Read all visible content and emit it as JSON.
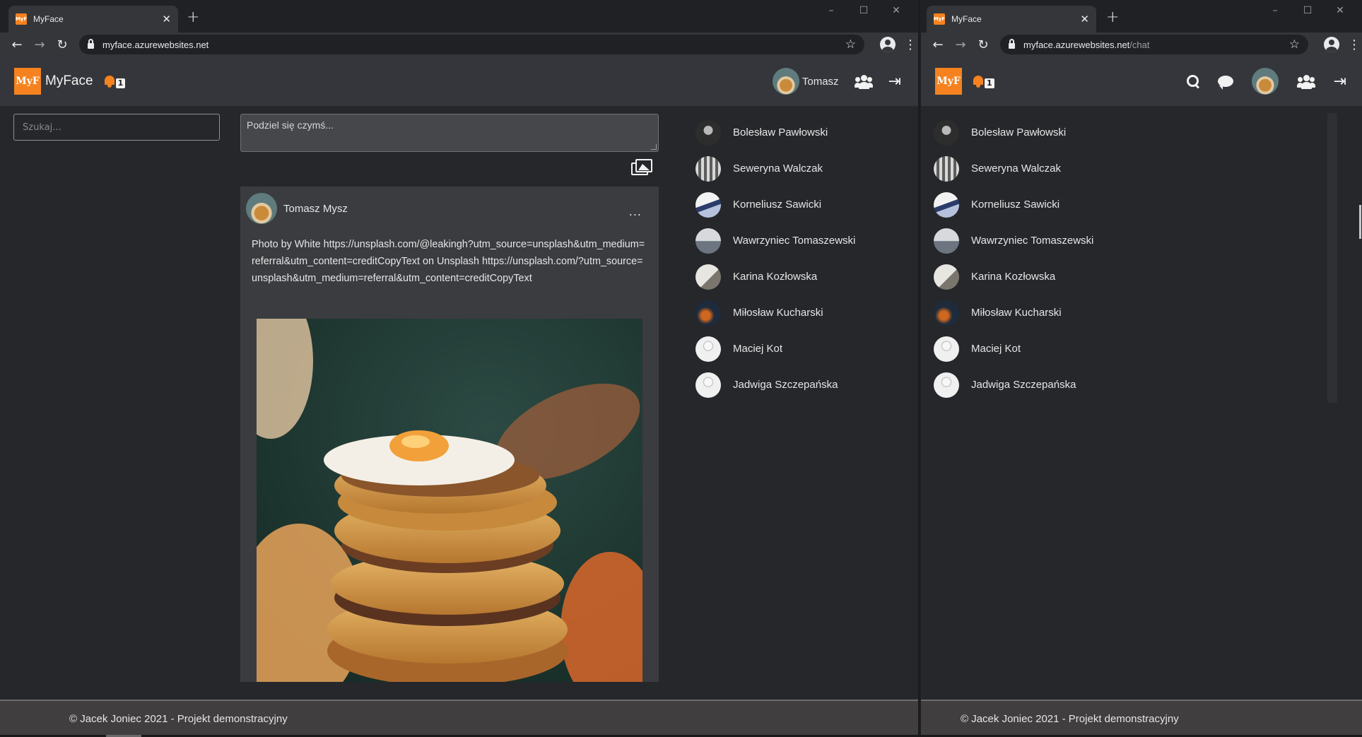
{
  "colors": {
    "accent": "#f5821f",
    "page_bg": "#25272b",
    "navbar_bg": "#34363b",
    "card_bg": "#3a3c40",
    "footer_bg": "#403e3e"
  },
  "left_window": {
    "tab_title": "MyFace",
    "url": "myface.azurewebsites.net",
    "brand": {
      "logo_text": "MyF",
      "name": "MyFace"
    },
    "notifications": {
      "icon": "bell-icon",
      "count": "1"
    },
    "user_name": "Tomasz",
    "search_placeholder": "Szukaj...",
    "share_placeholder": "Podziel się czymś...",
    "post": {
      "author": "Tomasz Mysz",
      "menu": "...",
      "text": "Photo by White https://unsplash.com/@leakingh?utm_source=unsplash&utm_medium=referral&utm_content=creditCopyText on Unsplash https://unsplash.com/?utm_source=unsplash&utm_medium=referral&utm_content=creditCopyText"
    },
    "footer": "© Jacek Joniec 2021 - Projekt demonstracyjny"
  },
  "right_window": {
    "tab_title": "MyFace",
    "url_host": "myface.azurewebsites.net",
    "url_path": "/chat",
    "brand": {
      "logo_text": "MyF"
    },
    "notifications": {
      "icon": "bell-icon",
      "count": "1"
    },
    "footer": "© Jacek Joniec 2021 - Projekt demonstracyjny"
  },
  "people": [
    {
      "name": "Bolesław Pawłowski"
    },
    {
      "name": "Seweryna Walczak"
    },
    {
      "name": "Korneliusz Sawicki"
    },
    {
      "name": "Wawrzyniec Tomaszewski"
    },
    {
      "name": "Karina Kozłowska"
    },
    {
      "name": "Miłosław Kucharski"
    },
    {
      "name": "Maciej Kot"
    },
    {
      "name": "Jadwiga Szczepańska"
    }
  ]
}
